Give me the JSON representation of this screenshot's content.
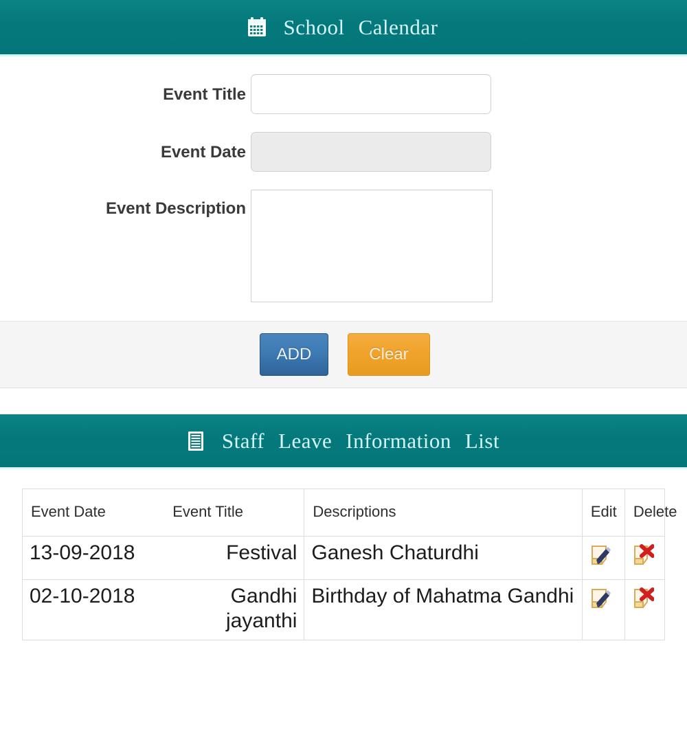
{
  "calendar_panel": {
    "icon": "calendar-icon",
    "title_words": [
      "School",
      "Calendar"
    ],
    "fields": [
      {
        "label": "Event Title",
        "value": "",
        "placeholder": "",
        "disabled": false,
        "type": "text"
      },
      {
        "label": "Event Date",
        "value": "",
        "placeholder": "",
        "disabled": true,
        "type": "text"
      },
      {
        "label": "Event Description",
        "value": "",
        "placeholder": "",
        "disabled": false,
        "type": "textarea"
      }
    ],
    "buttons": {
      "add_label": "ADD",
      "clear_label": "Clear"
    }
  },
  "list_panel": {
    "icon": "list-document-icon",
    "title_words": [
      "Staff",
      "Leave",
      "Information",
      "List"
    ],
    "table": {
      "columns": [
        "Event Date",
        "Event Title",
        "Descriptions",
        "Edit",
        "Delete"
      ],
      "rows": [
        {
          "event_date": "13-09-2018",
          "event_title": "Festival",
          "description": "Ganesh Chaturdhi",
          "edit_icon": "edit-note-pencil-icon",
          "delete_icon": "delete-note-cross-icon"
        },
        {
          "event_date": "02-10-2018",
          "event_title": "Gandhi jayanthi",
          "description": "Birthday of Mahatma Gandhi",
          "edit_icon": "edit-note-pencil-icon",
          "delete_icon": "delete-note-cross-icon"
        }
      ]
    }
  },
  "colors": {
    "panel_teal": "#04797c",
    "panel_text": "#d5f6f8",
    "panel_underline": "#cdf3f6",
    "add_button": "#3d79b3",
    "clear_button": "#f0a22a",
    "button_bar_bg": "#f5f5f6",
    "disabled_field": "#ebebeb",
    "table_border": "#dcdcdc",
    "edit_pencil": "#2e3a63",
    "delete_cross": "#d11f1f",
    "note_paper": "#f7d794"
  }
}
